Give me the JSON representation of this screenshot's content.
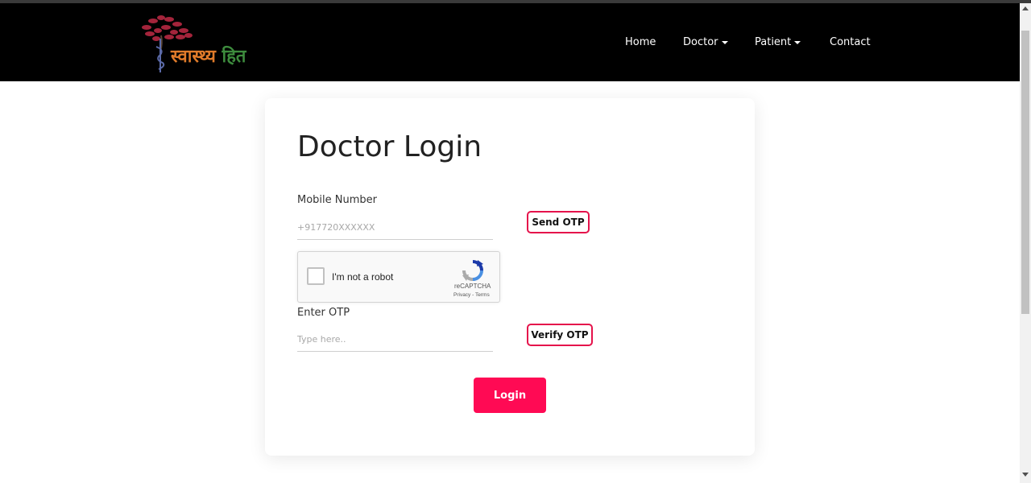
{
  "brand": {
    "word1": "स्वास्थ्य",
    "word2": "हित",
    "colors": {
      "word1": "#e07b2a",
      "word2": "#3d8b3d",
      "tree": "#a4243b",
      "staff": "#5b6aa8"
    }
  },
  "nav": {
    "items": [
      {
        "label": "Home",
        "dropdown": false
      },
      {
        "label": "Doctor",
        "dropdown": true
      },
      {
        "label": "Patient",
        "dropdown": true
      },
      {
        "label": "Contact",
        "dropdown": false
      }
    ]
  },
  "form": {
    "title": "Doctor Login",
    "mobile": {
      "label": "Mobile Number",
      "placeholder": "+917720XXXXXX",
      "value": ""
    },
    "send_otp_label": "Send OTP",
    "recaptcha": {
      "label": "I'm not a robot",
      "brand": "reCAPTCHA",
      "privacy": "Privacy",
      "separator": "-",
      "terms": "Terms",
      "checked": false
    },
    "otp": {
      "label": "Enter OTP",
      "placeholder": "Type here..",
      "value": ""
    },
    "verify_otp_label": "Verify OTP",
    "login_label": "Login"
  },
  "theme": {
    "accent": "#ff0a54",
    "outline": "#e5124b",
    "navbar_bg": "#000000"
  }
}
